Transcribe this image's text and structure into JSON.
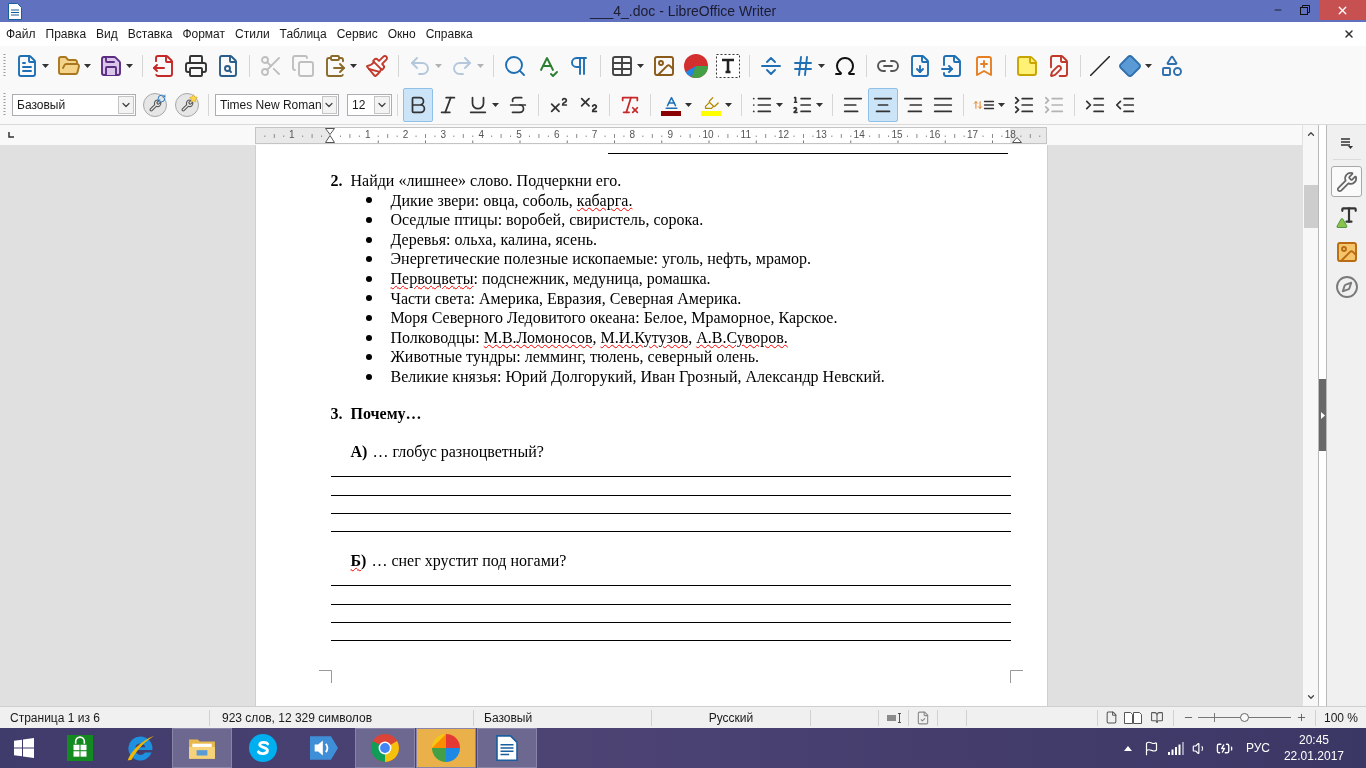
{
  "window": {
    "title": "___4_.doc - LibreOffice Writer"
  },
  "menu_bar": [
    "Файл",
    "Правка",
    "Вид",
    "Вставка",
    "Формат",
    "Стили",
    "Таблица",
    "Сервис",
    "Окно",
    "Справка"
  ],
  "standard_toolbar": [
    [
      {
        "kind": "new",
        "dropdown": true,
        "disabled": false
      },
      {
        "kind": "open",
        "dropdown": true,
        "disabled": false
      },
      {
        "kind": "save",
        "dropdown": true,
        "disabled": false
      }
    ],
    [
      {
        "kind": "export_pdf",
        "dropdown": false,
        "disabled": false
      },
      {
        "kind": "print",
        "dropdown": false,
        "disabled": false
      },
      {
        "kind": "print_preview",
        "dropdown": false,
        "disabled": false
      }
    ],
    [
      {
        "kind": "cut",
        "dropdown": false,
        "disabled": true
      },
      {
        "kind": "copy",
        "dropdown": false,
        "disabled": true
      },
      {
        "kind": "paste",
        "dropdown": true,
        "disabled": false
      },
      {
        "kind": "clone_formatting",
        "dropdown": false,
        "disabled": false
      }
    ],
    [
      {
        "kind": "undo",
        "dropdown": true,
        "disabled": true
      },
      {
        "kind": "redo",
        "dropdown": true,
        "disabled": true
      }
    ],
    [
      {
        "kind": "find_replace",
        "dropdown": false,
        "disabled": false
      },
      {
        "kind": "spelling",
        "dropdown": false,
        "disabled": false
      },
      {
        "kind": "formatting_marks",
        "dropdown": false,
        "disabled": false
      }
    ],
    [
      {
        "kind": "table",
        "dropdown": true,
        "disabled": false
      },
      {
        "kind": "image",
        "dropdown": false,
        "disabled": false
      },
      {
        "kind": "chart",
        "dropdown": false,
        "disabled": false
      },
      {
        "kind": "text_box",
        "dropdown": false,
        "disabled": false
      }
    ],
    [
      {
        "kind": "page_break",
        "dropdown": false,
        "disabled": false
      },
      {
        "kind": "field",
        "dropdown": true,
        "disabled": false
      },
      {
        "kind": "special_character",
        "dropdown": false,
        "disabled": false
      }
    ],
    [
      {
        "kind": "hyperlink",
        "dropdown": false,
        "disabled": false
      },
      {
        "kind": "footnote",
        "dropdown": false,
        "disabled": false
      },
      {
        "kind": "endnote",
        "dropdown": false,
        "disabled": false
      },
      {
        "kind": "bookmark",
        "dropdown": false,
        "disabled": false
      }
    ],
    [
      {
        "kind": "comment",
        "dropdown": false,
        "disabled": false
      },
      {
        "kind": "track_changes",
        "dropdown": false,
        "disabled": false
      }
    ],
    [
      {
        "kind": "line",
        "dropdown": false,
        "disabled": false
      },
      {
        "kind": "basic_shapes",
        "dropdown": true,
        "disabled": false
      },
      {
        "kind": "draw_functions",
        "dropdown": false,
        "disabled": false
      }
    ]
  ],
  "formatting_toolbar": [
    [
      {
        "kind": "paragraph_style_box",
        "value": "Базовый"
      },
      {
        "kind": "update_style",
        "selected": false,
        "dropdown": false,
        "disabled": false
      },
      {
        "kind": "new_style",
        "selected": false,
        "dropdown": false,
        "disabled": false
      }
    ],
    [
      {
        "kind": "font_name_box",
        "value": "Times New Roman"
      },
      {
        "kind": "font_size_box",
        "value": "12"
      }
    ],
    [
      {
        "kind": "bold",
        "selected": true,
        "dropdown": false,
        "disabled": false
      },
      {
        "kind": "italic",
        "selected": false,
        "dropdown": false,
        "disabled": false
      },
      {
        "kind": "underline",
        "selected": false,
        "dropdown": true,
        "disabled": false
      },
      {
        "kind": "strikethrough",
        "selected": false,
        "dropdown": false,
        "disabled": false
      }
    ],
    [
      {
        "kind": "superscript",
        "selected": false,
        "dropdown": false,
        "disabled": false
      },
      {
        "kind": "subscript",
        "selected": false,
        "dropdown": false,
        "disabled": false
      }
    ],
    [
      {
        "kind": "clear_formatting",
        "selected": false,
        "dropdown": false,
        "disabled": false
      }
    ],
    [
      {
        "kind": "font_color",
        "selected": false,
        "dropdown": true,
        "disabled": false
      },
      {
        "kind": "highlighting",
        "selected": false,
        "dropdown": true,
        "disabled": false
      }
    ],
    [
      {
        "kind": "bullets",
        "selected": false,
        "dropdown": true,
        "disabled": false
      },
      {
        "kind": "numbering",
        "selected": false,
        "dropdown": true,
        "disabled": false
      }
    ],
    [
      {
        "kind": "align_left",
        "selected": false,
        "dropdown": false,
        "disabled": false
      },
      {
        "kind": "align_center",
        "selected": true,
        "dropdown": false,
        "disabled": false
      },
      {
        "kind": "align_right",
        "selected": false,
        "dropdown": false,
        "disabled": false
      },
      {
        "kind": "justify",
        "selected": false,
        "dropdown": false,
        "disabled": false
      }
    ],
    [
      {
        "kind": "line_spacing",
        "selected": false,
        "dropdown": true,
        "disabled": false
      },
      {
        "kind": "increase_spacing",
        "selected": false,
        "dropdown": false,
        "disabled": false
      },
      {
        "kind": "decrease_spacing",
        "selected": false,
        "dropdown": false,
        "disabled": true
      }
    ],
    [
      {
        "kind": "increase_indent",
        "selected": false,
        "dropdown": false,
        "disabled": false
      },
      {
        "kind": "decrease_indent",
        "selected": false,
        "dropdown": false,
        "disabled": false
      }
    ]
  ],
  "ruler": {
    "left_labels": [
      "1"
    ],
    "labels": [
      "1",
      "2",
      "3",
      "4",
      "5",
      "6",
      "7",
      "8",
      "9",
      "10",
      "11",
      "12",
      "13",
      "14",
      "15",
      "16",
      "17",
      "18"
    ]
  },
  "document": {
    "content": [
      {
        "kind": "partial_line"
      },
      {
        "kind": "task",
        "number": "2.",
        "text": "Найди «лишнее» слово. Подчеркни его.",
        "bold": false
      },
      {
        "kind": "bullet_list",
        "items": [
          {
            "segments": [
              {
                "text": "Дикие звери: овца, соболь, ",
                "misspelled": false
              },
              {
                "text": "кабарга.",
                "misspelled": true
              }
            ]
          },
          {
            "segments": [
              {
                "text": "Оседлые птицы: воробей, свиристель, сорока.",
                "misspelled": false
              }
            ]
          },
          {
            "segments": [
              {
                "text": "Деревья: ольха, калина, ясень.",
                "misspelled": false
              }
            ]
          },
          {
            "segments": [
              {
                "text": "Энергетические полезные ископаемые: уголь, нефть, мрамор.",
                "misspelled": false
              }
            ]
          },
          {
            "segments": [
              {
                "text": "Первоцветы",
                "misspelled": true
              },
              {
                "text": ": подснежник, медуница, ромашка.",
                "misspelled": false
              }
            ]
          },
          {
            "segments": [
              {
                "text": "Части света: Америка, Евразия, Северная Америка.",
                "misspelled": false
              }
            ]
          },
          {
            "segments": [
              {
                "text": "Моря Северного Ледовитого океана: Белое, Мраморное, Карское.",
                "misspelled": false
              }
            ]
          },
          {
            "segments": [
              {
                "text": "Полководцы: ",
                "misspelled": false
              },
              {
                "text": "М.В.Ломоносов",
                "misspelled": true
              },
              {
                "text": ", ",
                "misspelled": false
              },
              {
                "text": "М.И.Кутузов",
                "misspelled": true
              },
              {
                "text": ", ",
                "misspelled": false
              },
              {
                "text": "А.В.Суворов.",
                "misspelled": true
              }
            ]
          },
          {
            "segments": [
              {
                "text": "Животные тундры: лемминг, тюлень, северный олень.",
                "misspelled": false
              }
            ]
          },
          {
            "segments": [
              {
                "text": "Великие князья: Юрий Долгорукий, Иван Грозный, Александр Невский.",
                "misspelled": false
              }
            ]
          }
        ]
      },
      {
        "kind": "task",
        "number": "3.",
        "text": "Почему…",
        "bold": true
      },
      {
        "kind": "question",
        "letter": [
          {
            "text": "А)",
            "misspelled": false
          }
        ],
        "text": "… глобус разноцветный?"
      },
      {
        "kind": "answer_line"
      },
      {
        "kind": "answer_line"
      },
      {
        "kind": "answer_line"
      },
      {
        "kind": "answer_line"
      },
      {
        "kind": "question",
        "letter": [
          {
            "text": "Б",
            "misspelled": true
          },
          {
            "text": ")",
            "misspelled": false
          }
        ],
        "text": "… снег хрустит под ногами?"
      },
      {
        "kind": "answer_line"
      },
      {
        "kind": "answer_line"
      },
      {
        "kind": "answer_line"
      },
      {
        "kind": "answer_line"
      },
      {
        "kind": "corner_marks"
      }
    ]
  },
  "sidebar": {
    "decks": [
      {
        "kind": "properties",
        "selected": true
      },
      {
        "kind": "styles",
        "selected": false
      },
      {
        "kind": "gallery",
        "selected": false
      },
      {
        "kind": "navigator",
        "selected": false
      }
    ]
  },
  "status_bar": {
    "page": "Страница 1 из 6",
    "word_count": "923 слов, 12 329 символов",
    "page_style": "Базовый",
    "language": "Русский",
    "zoom": {
      "level": 0.5,
      "reading": "100 %"
    }
  },
  "taskbar": {
    "apps": [
      {
        "kind": "store",
        "open": false,
        "attention": false
      },
      {
        "kind": "browser_e",
        "open": false,
        "attention": false
      },
      {
        "kind": "folder",
        "open": true,
        "attention": false
      },
      {
        "kind": "messenger",
        "open": false,
        "attention": false
      },
      {
        "kind": "speaker",
        "open": false,
        "attention": false
      },
      {
        "kind": "browser_circle",
        "open": true,
        "attention": false
      },
      {
        "kind": "polygon_ball",
        "open": true,
        "attention": true
      },
      {
        "kind": "writer",
        "open": true,
        "attention": false
      }
    ],
    "tray": {
      "language": "РУС",
      "time": "20:45",
      "date": "22.01.2017"
    }
  }
}
